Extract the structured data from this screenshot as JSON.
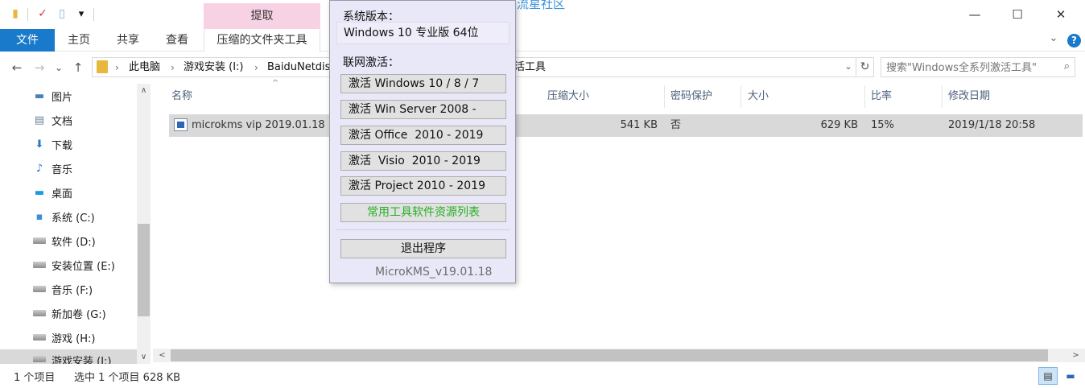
{
  "window": {
    "context_tab": "提取",
    "watermark": "流星社区",
    "min_glyph": "—",
    "max_glyph": "☐",
    "close_glyph": "✕",
    "qat_dropdown_glyph": "▾"
  },
  "ribbon": {
    "tabs": [
      "文件",
      "主页",
      "共享",
      "查看",
      "压缩的文件夹工具"
    ],
    "collapse_glyph": "⌄",
    "help_glyph": "?"
  },
  "nav": {
    "back": "←",
    "forward": "→",
    "history": "⌄",
    "up": "↑",
    "crumbs": [
      "此电脑",
      "游戏安装 (I:)",
      "BaiduNetdis"
    ],
    "crumb_sep": "›",
    "tail": "活工具",
    "dropdown": "⌄",
    "refresh": "↻"
  },
  "search": {
    "placeholder": "搜索\"Windows全系列激活工具\"",
    "icon_glyph": "⌕"
  },
  "sidebar": {
    "items": [
      {
        "label": "图片",
        "icon": "pictures-icon"
      },
      {
        "label": "文档",
        "icon": "documents-icon"
      },
      {
        "label": "下载",
        "icon": "downloads-icon"
      },
      {
        "label": "音乐",
        "icon": "music-icon"
      },
      {
        "label": "桌面",
        "icon": "desktop-icon"
      },
      {
        "label": "系统 (C:)",
        "icon": "system-drive-icon"
      },
      {
        "label": "软件 (D:)",
        "icon": "drive-icon"
      },
      {
        "label": "安装位置 (E:)",
        "icon": "drive-icon"
      },
      {
        "label": "音乐 (F:)",
        "icon": "drive-icon"
      },
      {
        "label": "新加卷 (G:)",
        "icon": "drive-icon"
      },
      {
        "label": "游戏 (H:)",
        "icon": "drive-icon"
      },
      {
        "label": "游戏安装 (I:)",
        "icon": "drive-icon"
      }
    ],
    "scroll_up": "∧",
    "scroll_down": "∨"
  },
  "columns": {
    "name": "名称",
    "compressed_size": "压缩大小",
    "password": "密码保护",
    "size": "大小",
    "ratio": "比率",
    "modified": "修改日期",
    "sort_glyph": "^"
  },
  "files": [
    {
      "name": "microkms vip 2019.01.18",
      "compressed_size": "541 KB",
      "password": "否",
      "size": "629 KB",
      "ratio": "15%",
      "modified": "2019/1/18 20:58"
    }
  ],
  "hscroll": {
    "left": "<",
    "right": ">"
  },
  "status": {
    "count": "1 个项目",
    "selected": "选中 1 个项目 628 KB",
    "details_glyph": "▤",
    "tiles_glyph": "▬"
  },
  "kms": {
    "system_label": "系统版本：",
    "system_value": "Windows 10 专业版 64位",
    "activation_label": "联网激活：",
    "buttons": [
      "激活 Windows 10 / 8 / 7",
      "激活 Win Server 2008 -",
      "激活 Office  2010 - 2019",
      "激活  Visio  2010 - 2019",
      "激活 Project 2010 - 2019"
    ],
    "resources_button": "常用工具软件资源列表",
    "exit_button": "退出程序",
    "footer": "MicroKMS_v19.01.18",
    "colors": {
      "resources_text": "#23b023",
      "background": "#e9e8f8"
    }
  }
}
